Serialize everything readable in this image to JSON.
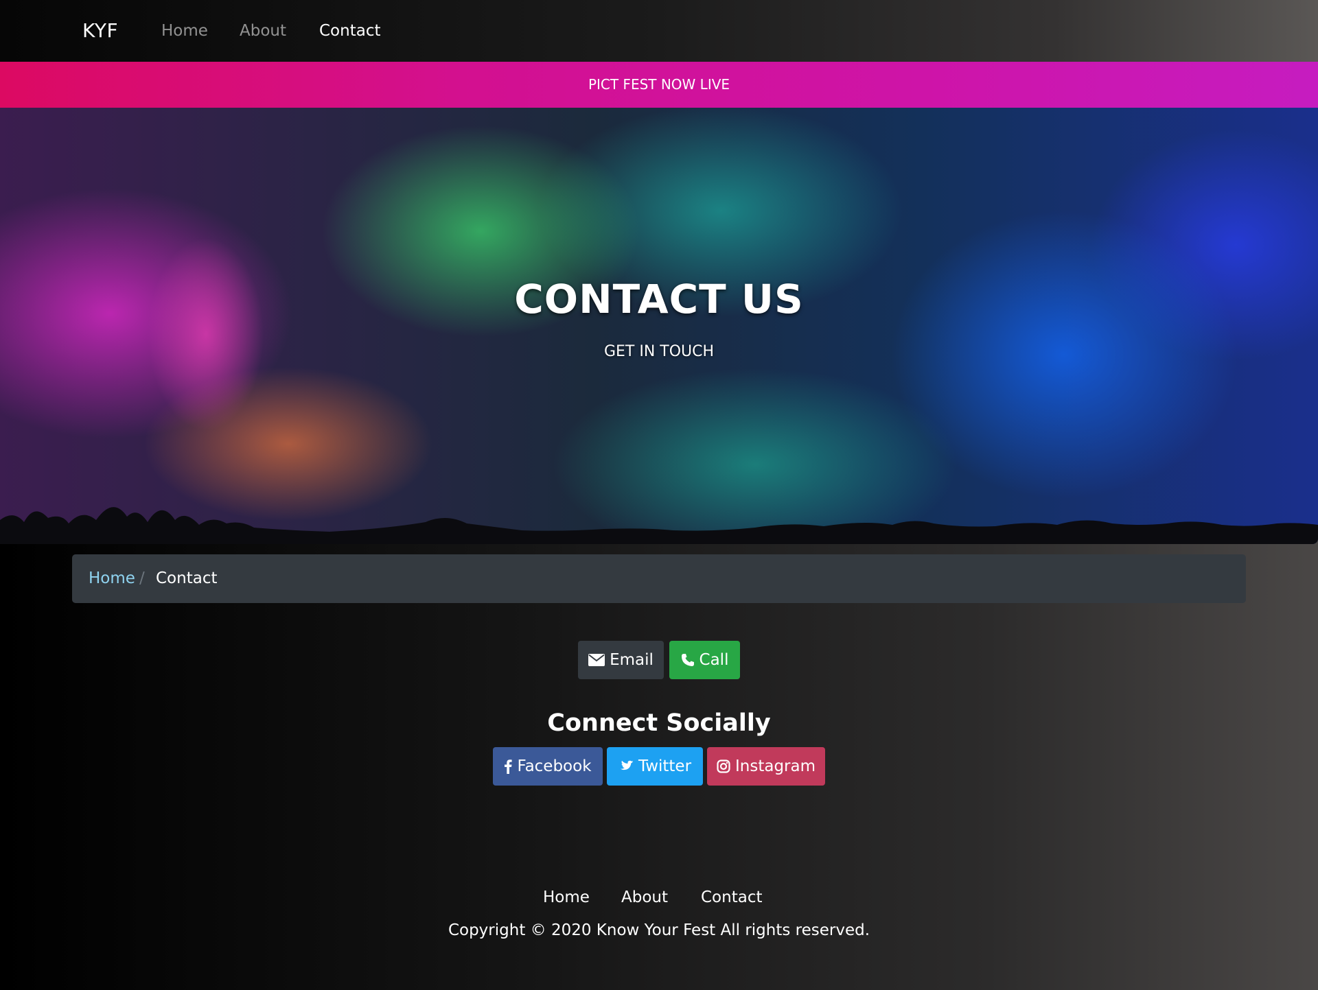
{
  "navbar": {
    "brand": "KYF",
    "links": [
      {
        "label": "Home",
        "active": false
      },
      {
        "label": "About",
        "active": false
      },
      {
        "label": "Contact",
        "active": true
      }
    ]
  },
  "banner": {
    "text": "PICT FEST NOW LIVE"
  },
  "hero": {
    "title": "CONTACT US",
    "subtitle": "GET IN TOUCH"
  },
  "breadcrumb": {
    "home": "Home",
    "separator": "/",
    "current": "Contact"
  },
  "contact": {
    "email_label": "Email",
    "call_label": "Call"
  },
  "social": {
    "heading": "Connect Socially",
    "facebook_label": "Facebook",
    "twitter_label": "Twitter",
    "instagram_label": "Instagram"
  },
  "footer": {
    "links": [
      "Home",
      "About",
      "Contact"
    ],
    "copyright": "Copyright © 2020 Know Your Fest All rights reserved."
  },
  "colors": {
    "banner_gradient": [
      "#dc0a62",
      "#c61cc0"
    ],
    "breadcrumb_bg": "#343a40",
    "breadcrumb_link": "#8fd3f0",
    "email_button": "#343a40",
    "call_button": "#28a745",
    "facebook_button": "#3b5998",
    "twitter_button": "#1da1f2",
    "instagram_button": "#c13a5b"
  },
  "icons": {
    "email": "envelope-icon",
    "call": "phone-icon",
    "facebook": "facebook-icon",
    "twitter": "twitter-icon",
    "instagram": "instagram-icon"
  }
}
